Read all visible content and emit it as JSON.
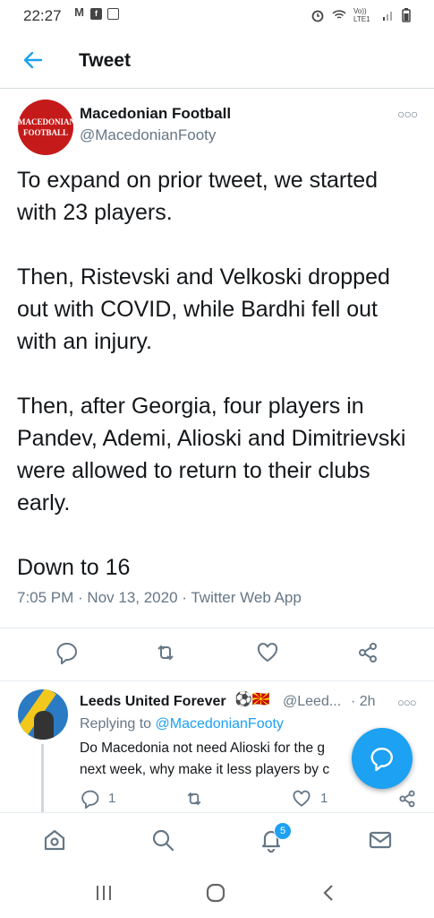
{
  "status_bar": {
    "time": "22:27",
    "net_label": "Vo)) LTE1"
  },
  "header": {
    "title": "Tweet"
  },
  "tweet": {
    "avatar_text_top": "MACEDONIAN",
    "avatar_text_bottom": "FOOTBALL",
    "name": "Macedonian Football",
    "handle": "@MacedonianFooty",
    "text": "To expand on prior tweet, we started with 23 players.\n\nThen, Ristevski and Velkoski dropped out with COVID, while Bardhi fell out with an injury.\n\nThen, after Georgia, four players in Pandev, Ademi, Alioski and Dimitrievski were allowed to return to their clubs early.\n\nDown to 16",
    "meta": "7:05 PM · Nov 13, 2020 · Twitter Web App"
  },
  "reply": {
    "name": "Leeds United Forever",
    "emoji": "⚽🇲🇰",
    "handle": "@Leed...",
    "time": "· 2h",
    "replying_prefix": "Replying to ",
    "replying_handle": "@MacedonianFooty",
    "line1": "Do Macedonia not need Alioski for the g",
    "line2": "next week, why make it less players by c",
    "reply_count": "1",
    "like_count": "1"
  },
  "bottom_nav": {
    "notifications_badge": "5"
  },
  "colors": {
    "accent": "#1da1f2",
    "text": "#14171a",
    "muted": "#657786",
    "avatar_bg": "#c51a1a"
  }
}
